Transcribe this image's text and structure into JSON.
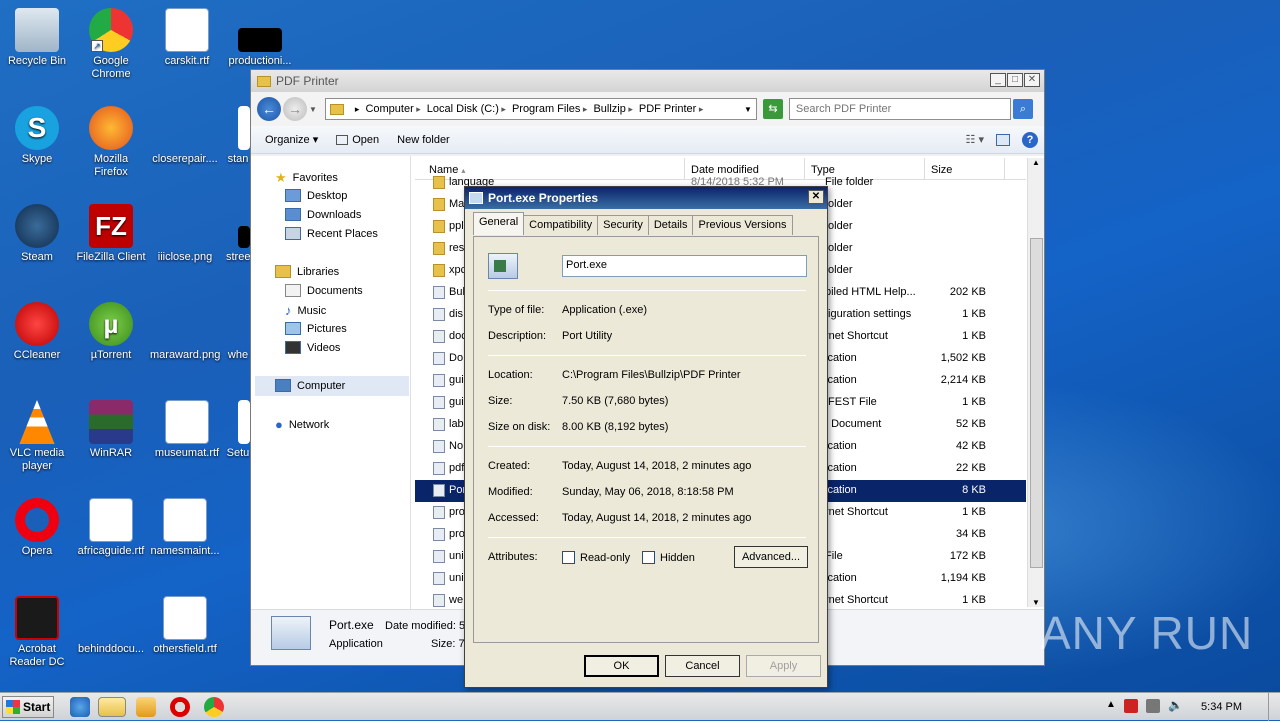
{
  "desktop": {
    "icons": [
      {
        "label": "Recycle Bin"
      },
      {
        "label": "Google Chrome"
      },
      {
        "label": "carskit.rtf"
      },
      {
        "label": "productioni..."
      },
      {
        "label": "Skype"
      },
      {
        "label": "Mozilla Firefox"
      },
      {
        "label": "closerepair...."
      },
      {
        "label": "stan"
      },
      {
        "label": "Steam"
      },
      {
        "label": "FileZilla Client"
      },
      {
        "label": "iiiclose.png"
      },
      {
        "label": "stree"
      },
      {
        "label": "CCleaner"
      },
      {
        "label": "µTorrent"
      },
      {
        "label": "maraward.png"
      },
      {
        "label": "whe"
      },
      {
        "label": "VLC media player"
      },
      {
        "label": "WinRAR"
      },
      {
        "label": "museumat.rtf"
      },
      {
        "label": "Setu"
      },
      {
        "label": "Opera"
      },
      {
        "label": "africaguide.rtf"
      },
      {
        "label": "namesmaint..."
      },
      {
        "label": "Acrobat Reader DC"
      },
      {
        "label": "behinddocu..."
      },
      {
        "label": "othersfield.rtf"
      }
    ]
  },
  "explorer": {
    "title": "PDF Printer",
    "breadcrumb": [
      "Computer",
      "Local Disk (C:)",
      "Program Files",
      "Bullzip",
      "PDF Printer"
    ],
    "search_placeholder": "Search PDF Printer",
    "toolbar": {
      "organize": "Organize ▾",
      "open": "Open",
      "new_folder": "New folder"
    },
    "nav": {
      "favorites": "Favorites",
      "desktop": "Desktop",
      "downloads": "Downloads",
      "recent": "Recent Places",
      "libraries": "Libraries",
      "documents": "Documents",
      "music": "Music",
      "pictures": "Pictures",
      "videos": "Videos",
      "computer": "Computer",
      "network": "Network"
    },
    "columns": {
      "name": "Name",
      "date": "Date modified",
      "type": "Type",
      "size": "Size"
    },
    "rows": [
      {
        "name": "language",
        "date": "8/14/2018 5:32 PM",
        "type": "File folder",
        "size": ""
      },
      {
        "name": "Ma",
        "type": "folder",
        "size": ""
      },
      {
        "name": "ppl",
        "type": "folder",
        "size": ""
      },
      {
        "name": "res",
        "type": "folder",
        "size": ""
      },
      {
        "name": "xpc",
        "type": "folder",
        "size": ""
      },
      {
        "name": "Bul",
        "type": "piled HTML Help...",
        "size": "202 KB"
      },
      {
        "name": "dis",
        "type": "figuration settings",
        "size": "1 KB"
      },
      {
        "name": "doc",
        "type": "rnet Shortcut",
        "size": "1 KB"
      },
      {
        "name": "Do",
        "type": "ication",
        "size": "1,502 KB"
      },
      {
        "name": "gui",
        "type": "ication",
        "size": "2,214 KB"
      },
      {
        "name": "gui",
        "type": "IFEST File",
        "size": "1 KB"
      },
      {
        "name": "lab",
        "type": "t Document",
        "size": "52 KB"
      },
      {
        "name": "No",
        "type": "ication",
        "size": "42 KB"
      },
      {
        "name": "pdf",
        "type": "ication",
        "size": "22 KB"
      },
      {
        "name": "Por",
        "type": "ication",
        "size": "8 KB"
      },
      {
        "name": "pro",
        "type": "rnet Shortcut",
        "size": "1 KB"
      },
      {
        "name": "pro",
        "type": "",
        "size": "34 KB"
      },
      {
        "name": "uni",
        "type": "File",
        "size": "172 KB"
      },
      {
        "name": "uni",
        "type": "ication",
        "size": "1,194 KB"
      },
      {
        "name": "we",
        "type": "rnet Shortcut",
        "size": "1 KB"
      }
    ],
    "details": {
      "name": "Port.exe",
      "type": "Application",
      "date_label": "Date modified:  5",
      "size_label": "Size:  7"
    }
  },
  "dialog": {
    "title": "Port.exe Properties",
    "tabs": [
      "General",
      "Compatibility",
      "Security",
      "Details",
      "Previous Versions"
    ],
    "filename": "Port.exe",
    "type_label": "Type of file:",
    "type_value": "Application (.exe)",
    "desc_label": "Description:",
    "desc_value": "Port Utility",
    "loc_label": "Location:",
    "loc_value": "C:\\Program Files\\Bullzip\\PDF Printer",
    "size_label": "Size:",
    "size_value": "7.50 KB (7,680 bytes)",
    "disk_label": "Size on disk:",
    "disk_value": "8.00 KB (8,192 bytes)",
    "created_label": "Created:",
    "created_value": "Today, August 14, 2018, 2 minutes ago",
    "modified_label": "Modified:",
    "modified_value": "Sunday, May 06, 2018, 8:18:58 PM",
    "accessed_label": "Accessed:",
    "accessed_value": "Today, August 14, 2018, 2 minutes ago",
    "attr_label": "Attributes:",
    "readonly": "Read-only",
    "hidden": "Hidden",
    "advanced": "Advanced...",
    "ok": "OK",
    "cancel": "Cancel",
    "apply": "Apply"
  },
  "taskbar": {
    "start": "Start",
    "clock": "5:34 PM"
  },
  "watermark": "ANY RUN"
}
